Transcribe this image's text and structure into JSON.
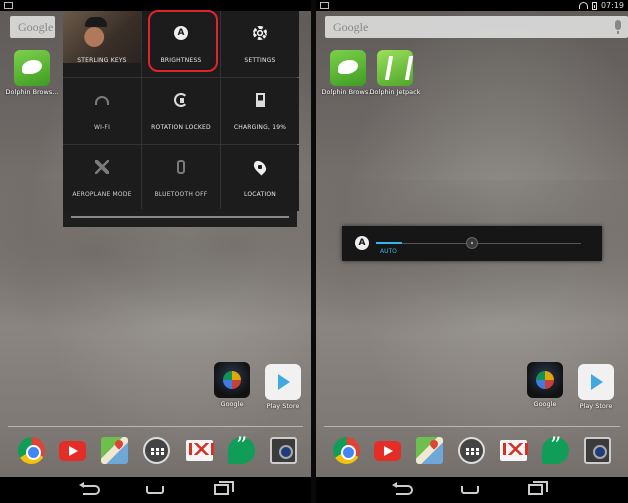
{
  "left_screen": {
    "search": {
      "logo_text": "Google"
    },
    "apps": [
      {
        "label": "Dolphin Brows..."
      }
    ],
    "quick_settings": {
      "tiles": [
        {
          "label": "STERLING KEYS",
          "icon": "user-photo"
        },
        {
          "label": "BRIGHTNESS",
          "icon": "brightness-auto-icon",
          "highlighted": true
        },
        {
          "label": "SETTINGS",
          "icon": "gear-icon"
        },
        {
          "label": "WI-FI",
          "icon": "wifi-icon"
        },
        {
          "label": "ROTATION LOCKED",
          "icon": "rotation-lock-icon"
        },
        {
          "label": "CHARGING, 19%",
          "icon": "battery-charging-icon"
        },
        {
          "label": "AEROPLANE MODE",
          "icon": "airplane-icon"
        },
        {
          "label": "BLUETOOTH OFF",
          "icon": "bluetooth-icon"
        },
        {
          "label": "LOCATION",
          "icon": "location-icon"
        }
      ],
      "highlight_color": "#e0232e"
    },
    "home_apps": [
      {
        "label": "Google"
      },
      {
        "label": "Play Store"
      }
    ]
  },
  "right_screen": {
    "status": {
      "time": "07:19"
    },
    "search": {
      "logo_text": "Google"
    },
    "apps": [
      {
        "label": "Dolphin Brows..."
      },
      {
        "label": "Dolphin Jetpack"
      }
    ],
    "brightness_dialog": {
      "auto_icon_letter": "A",
      "auto_label": "AUTO",
      "level_fraction": 0.47,
      "accent_color": "#33b5e5"
    },
    "home_apps": [
      {
        "label": "Google"
      },
      {
        "label": "Play Store"
      }
    ]
  },
  "dock": [
    "chrome-icon",
    "youtube-icon",
    "maps-icon",
    "app-drawer-icon",
    "gmail-icon",
    "hangouts-icon",
    "camera-icon"
  ],
  "nav": [
    "back-icon",
    "home-icon",
    "recent-apps-icon"
  ]
}
